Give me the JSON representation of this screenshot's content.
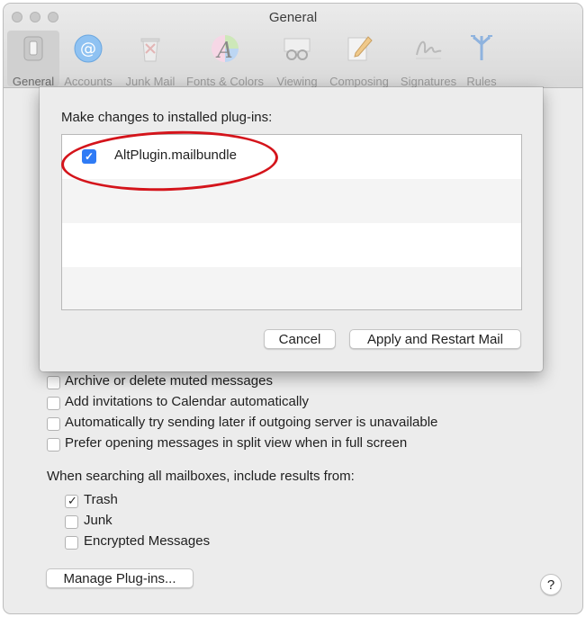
{
  "window": {
    "title": "General"
  },
  "toolbar": {
    "items": [
      {
        "label": "General",
        "icon": "switch-icon"
      },
      {
        "label": "Accounts",
        "icon": "at-sign-icon"
      },
      {
        "label": "Junk Mail",
        "icon": "trash-bin-icon"
      },
      {
        "label": "Fonts & Colors",
        "icon": "font-color-wheel-icon"
      },
      {
        "label": "Viewing",
        "icon": "glasses-icon"
      },
      {
        "label": "Composing",
        "icon": "pencil-paper-icon"
      },
      {
        "label": "Signatures",
        "icon": "signature-icon"
      },
      {
        "label": "Rules",
        "icon": "rules-arrows-icon"
      }
    ]
  },
  "sheet": {
    "heading": "Make changes to installed plug-ins:",
    "plugins": [
      {
        "name": "AltPlugin.mailbundle",
        "checked": true
      }
    ],
    "cancel_label": "Cancel",
    "apply_label": "Apply and Restart Mail"
  },
  "options": [
    {
      "label": "Archive or delete muted messages",
      "checked": false
    },
    {
      "label": "Add invitations to Calendar automatically",
      "checked": false
    },
    {
      "label": "Automatically try sending later if outgoing server is unavailable",
      "checked": false
    },
    {
      "label": "Prefer opening messages in split view when in full screen",
      "checked": false
    }
  ],
  "search": {
    "heading": "When searching all mailboxes, include results from:",
    "items": [
      {
        "label": "Trash",
        "checked": true
      },
      {
        "label": "Junk",
        "checked": false
      },
      {
        "label": "Encrypted Messages",
        "checked": false
      }
    ]
  },
  "manage_label": "Manage Plug-ins...",
  "help_label": "?",
  "colors": {
    "accent": "#2f7bf5",
    "highlight": "#d4141b"
  }
}
